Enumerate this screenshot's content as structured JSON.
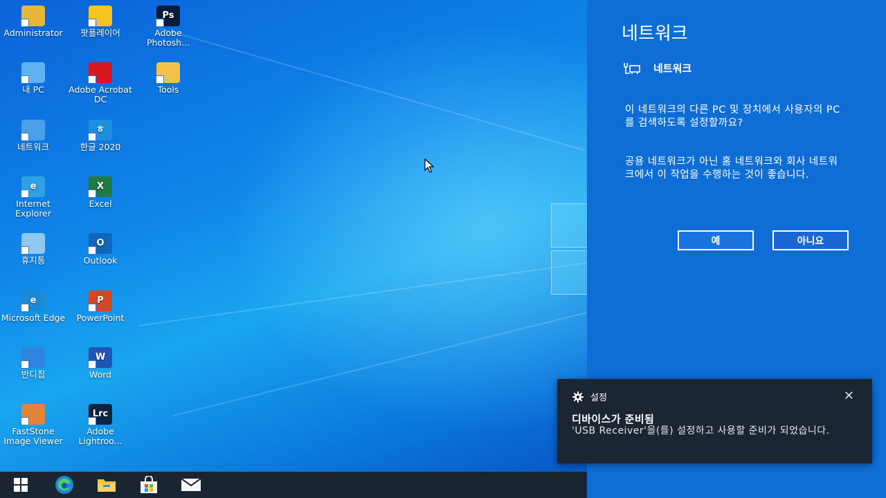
{
  "desktop": {
    "icons": [
      {
        "label": "Administrator",
        "icon": "user-folder-icon",
        "color": "#e8b73a"
      },
      {
        "label": "팟플레이어",
        "icon": "potplayer-icon",
        "color": "#f3c51d"
      },
      {
        "label": "Adobe Photosh...",
        "icon": "photoshop-icon",
        "color": "#0a1a3a",
        "glyph": "Ps"
      },
      {
        "label": "내 PC",
        "icon": "computer-icon",
        "color": "#5fb3f0"
      },
      {
        "label": "Adobe Acrobat DC",
        "icon": "acrobat-icon",
        "color": "#d7191f"
      },
      {
        "label": "Tools",
        "icon": "tools-folder-icon",
        "color": "#f0c24a"
      },
      {
        "label": "네트워크",
        "icon": "network-icon",
        "color": "#4aa0e8"
      },
      {
        "label": "한글 2020",
        "icon": "hangul-icon",
        "color": "#1c8fe0",
        "glyph": "ㅎ"
      },
      {
        "label": "Internet Explorer",
        "icon": "internet-explorer-icon",
        "color": "#2f9fe6",
        "glyph": "e"
      },
      {
        "label": "Excel",
        "icon": "excel-icon",
        "color": "#1f7a44",
        "glyph": "X"
      },
      {
        "label": "휴지통",
        "icon": "recycle-bin-icon",
        "color": "#8ec8ef"
      },
      {
        "label": "Outlook",
        "icon": "outlook-icon",
        "color": "#1265b8",
        "glyph": "O"
      },
      {
        "label": "Microsoft Edge",
        "icon": "edge-icon",
        "color": "#1d8ad6",
        "glyph": "e"
      },
      {
        "label": "PowerPoint",
        "icon": "powerpoint-icon",
        "color": "#d24726",
        "glyph": "P"
      },
      {
        "label": "반디집",
        "icon": "bandizip-icon",
        "color": "#2f84de"
      },
      {
        "label": "Word",
        "icon": "word-icon",
        "color": "#1f56b5",
        "glyph": "W"
      },
      {
        "label": "FastStone Image Viewer",
        "icon": "faststone-icon",
        "color": "#e2843a"
      },
      {
        "label": "Adobe Lightroo...",
        "icon": "lightroom-icon",
        "color": "#0c2440",
        "glyph": "Lrc"
      }
    ]
  },
  "taskbar": {
    "items": [
      {
        "icon": "windows-start-icon"
      },
      {
        "icon": "edge-taskbar-icon"
      },
      {
        "icon": "file-explorer-icon"
      },
      {
        "icon": "microsoft-store-icon"
      },
      {
        "icon": "mail-icon"
      }
    ]
  },
  "network_flyout": {
    "title": "네트워크",
    "network_name": "네트워크",
    "question": "이 네트워크의 다른 PC 및 장치에서 사용자의 PC를 검색하도록 설정할까요?",
    "advice": "공용 네트워크가 아닌 홈 네트워크와 회사 네트워크에서 이 작업을 수행하는 것이 좋습니다.",
    "yes_label": "예",
    "no_label": "아니요"
  },
  "toast": {
    "app_name": "설정",
    "title": "디바이스가 준비됨",
    "body": "'USB Receiver'을(를) 설정하고 사용할 준비가 되었습니다.",
    "close_glyph": "✕"
  },
  "colors": {
    "flyout_bg": "#0f6ed6",
    "toast_bg": "#1c2633",
    "taskbar_bg": "#1b2532"
  }
}
